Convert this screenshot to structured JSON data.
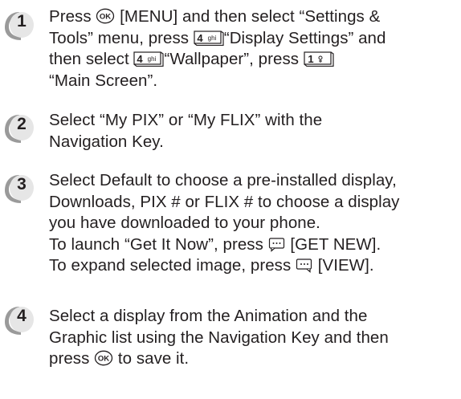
{
  "steps": [
    {
      "number": "1",
      "line1_a": "Press ",
      "line1_ok_icon": "ok-key-icon",
      "line1_b": " [MENU] and then select “Settings &",
      "line2_a": "Tools” menu, press ",
      "line2_key_icon": "key-4-ghi-icon",
      "line2_b": "“Display Settings” and",
      "line3_a": "then select ",
      "line3_key_icon": "key-4-ghi-icon",
      "line3_b": "“Wallpaper”, press ",
      "line3_key2_icon": "key-1-voicemail-icon",
      "line4": "“Main Screen”."
    },
    {
      "number": "2",
      "line1": "Select “My PIX” or “My FLIX” with the",
      "line2": "Navigation Key."
    },
    {
      "number": "3",
      "line1": "Select Default to choose a pre-installed display,",
      "line2": "Downloads, PIX # or FLIX # to choose a display",
      "line3": "you have downloaded to your phone.",
      "line4_a": "To launch “Get It Now”, press ",
      "line4_key_icon": "left-soft-key-icon",
      "line4_b": " [GET NEW].",
      "line5_a": "To expand selected image, press ",
      "line5_key_icon": "right-soft-key-icon",
      "line5_b": " [VIEW]."
    },
    {
      "number": "4",
      "line1": "Select a display from the Animation and the",
      "line2": "Graphic list using the Navigation Key and then",
      "line3_a": "press ",
      "line3_ok_icon": "ok-key-icon",
      "line3_b": " to save it."
    }
  ],
  "keys": {
    "ok_label": "OK",
    "key4_digit": "4",
    "key4_letters": "ghi",
    "key1_digit": "1"
  },
  "colors": {
    "text": "#231f20",
    "badge_light": "#e6e6e6",
    "badge_shadow": "#9a9a9a"
  }
}
